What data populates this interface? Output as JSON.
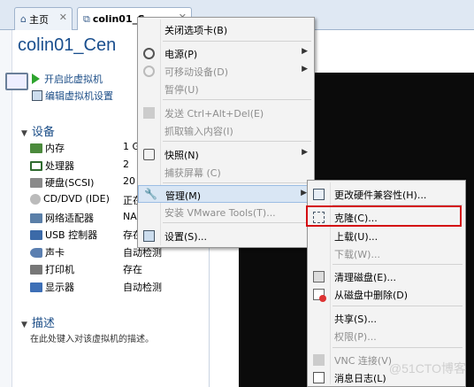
{
  "tabs": {
    "home_label": "主页",
    "vm_label": "colin01_C"
  },
  "vm": {
    "title": "colin01_Cen"
  },
  "actions": {
    "start": "开启此虚拟机",
    "edit": "编辑虚拟机设置"
  },
  "devices": {
    "header": "设备",
    "items": [
      {
        "name": "内存",
        "value": "1 G"
      },
      {
        "name": "处理器",
        "value": "2"
      },
      {
        "name": "硬盘(SCSI)",
        "value": "20"
      },
      {
        "name": "CD/DVD (IDE)",
        "value": "正在"
      },
      {
        "name": "网络适配器",
        "value": "NA"
      },
      {
        "name": "USB 控制器",
        "value": "存在"
      },
      {
        "name": "声卡",
        "value": "自动检测"
      },
      {
        "name": "打印机",
        "value": "存在"
      },
      {
        "name": "显示器",
        "value": "自动检测"
      }
    ]
  },
  "description": {
    "header": "描述",
    "text": "在此处键入对该虚拟机的描述。"
  },
  "context_menu": {
    "close_tab": "关闭选项卡(B)",
    "power": "电源(P)",
    "removable": "可移动设备(D)",
    "pause": "暂停(U)",
    "send_cad": "发送 Ctrl+Alt+Del(E)",
    "grab_input": "抓取输入内容(I)",
    "snapshot": "快照(N)",
    "capture_screen": "捕获屏幕 (C)",
    "manage": "管理(M)",
    "install_tools": "安装 VMware Tools(T)...",
    "settings": "设置(S)..."
  },
  "submenu": {
    "change_hw": "更改硬件兼容性(H)...",
    "clone": "克隆(C)...",
    "upload": "上载(U)...",
    "download": "下载(W)...",
    "clean_disk": "清理磁盘(E)...",
    "delete_disk": "从磁盘中删除(D)",
    "share": "共享(S)...",
    "permissions": "权限(P)...",
    "vnc": "VNC 连接(V)",
    "log": "消息日志(L)"
  },
  "watermark": "@51CTO博客"
}
